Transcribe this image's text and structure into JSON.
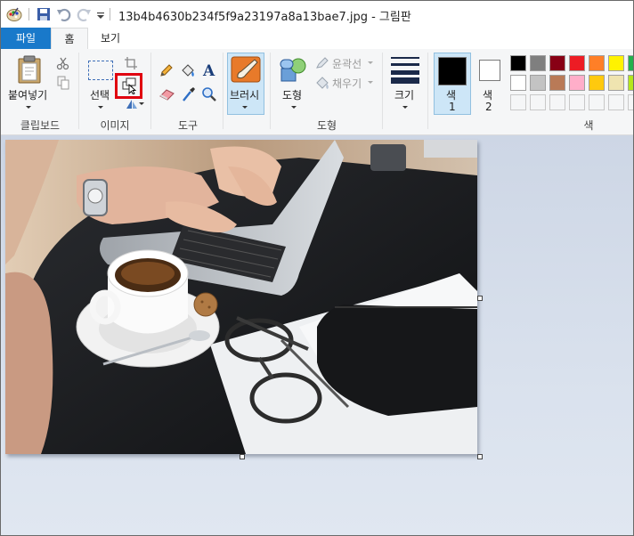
{
  "window": {
    "title": "13b4b4630b234f5f9a23197a8a13bae7.jpg - 그림판"
  },
  "quick_access": {
    "app_icon": "paint-palette-icon",
    "save_icon": "save-icon",
    "undo_icon": "undo-icon",
    "redo_icon": "redo-icon",
    "customize_icon": "customize-dropdown-icon"
  },
  "tabs": [
    {
      "label": "파일",
      "active": false
    },
    {
      "label": "홈",
      "active": true
    },
    {
      "label": "보기",
      "active": false
    }
  ],
  "ribbon": {
    "clipboard": {
      "group_label": "클립보드",
      "paste_label": "붙여넣기",
      "cut_icon": "scissors-icon",
      "copy_icon": "copy-icon"
    },
    "image": {
      "group_label": "이미지",
      "select_label": "선택",
      "crop_icon": "crop-icon",
      "resize_icon": "resize-icon",
      "rotate_icon": "rotate-icon",
      "highlight_color": "#e0000f"
    },
    "tools": {
      "group_label": "도구",
      "pencil_icon": "pencil-icon",
      "fill_icon": "fill-bucket-icon",
      "text_icon": "text-icon",
      "eraser_icon": "eraser-icon",
      "picker_icon": "color-picker-icon",
      "magnifier_icon": "magnifier-icon"
    },
    "brush": {
      "label": "브러시",
      "icon": "brush-icon"
    },
    "shapes": {
      "group_label": "도형",
      "shapes_label": "도형",
      "outline_label": "윤곽선",
      "fill_label": "채우기"
    },
    "size": {
      "label": "크기"
    },
    "colors": {
      "group_label": "색",
      "color1_label": "색",
      "color1_num": "1",
      "color2_label": "색",
      "color2_num": "2",
      "color1_value": "#000000",
      "color2_value": "#ffffff",
      "palette_row1": [
        "#000000",
        "#7f7f7f",
        "#880015",
        "#ed1c24",
        "#ff7f27",
        "#fff200",
        "#22b14c"
      ],
      "palette_row2": [
        "#ffffff",
        "#c3c3c3",
        "#b97a57",
        "#ffaec9",
        "#ffc90e",
        "#efe4b0",
        "#b5e61d"
      ]
    }
  },
  "canvas": {
    "image_description_icon": "photo-canvas"
  }
}
